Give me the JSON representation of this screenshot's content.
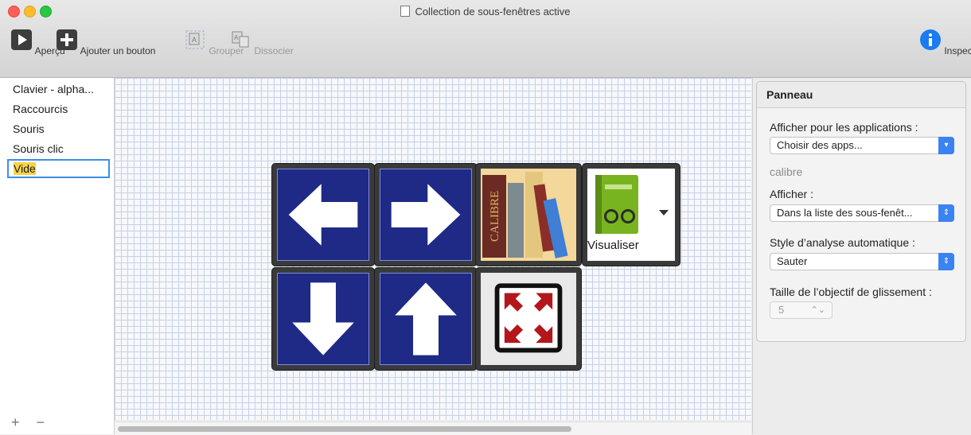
{
  "window": {
    "title": "Collection de sous-fenêtres active"
  },
  "toolbar": {
    "preview_label": "Aperçu",
    "add_button_label": "Ajouter un bouton",
    "group_label": "Grouper",
    "ungroup_label": "Dissocier",
    "inspector_label": "Inspecteur"
  },
  "sidebar": {
    "items": [
      {
        "label": "Clavier - alpha..."
      },
      {
        "label": "Raccourcis"
      },
      {
        "label": "Souris"
      },
      {
        "label": "Souris clic"
      },
      {
        "label": "Vide"
      }
    ],
    "bottom": "+ −"
  },
  "canvas": {
    "buttons": [
      {
        "name": "left-arrow",
        "icon": "arrow-left-icon"
      },
      {
        "name": "right-arrow",
        "icon": "arrow-right-icon"
      },
      {
        "name": "calibre",
        "icon": "calibre-books-icon",
        "text": "CALIBRE"
      },
      {
        "name": "visualiser",
        "icon": "green-book-glasses-icon",
        "label": "Visualiser"
      },
      {
        "name": "down-arrow",
        "icon": "arrow-down-icon"
      },
      {
        "name": "up-arrow",
        "icon": "arrow-up-icon"
      },
      {
        "name": "fullscreen",
        "icon": "expand-icon"
      }
    ]
  },
  "inspector": {
    "panel_title": "Panneau",
    "show_for_apps_label": "Afficher pour les applications :",
    "show_for_apps_value": "Choisir des apps...",
    "app_name": "calibre",
    "display_label": "Afficher :",
    "display_value": "Dans la liste des sous-fenêt...",
    "scan_style_label": "Style d’analyse automatique :",
    "scan_style_value": "Sauter",
    "swipe_target_label": "Taille de l’objectif de glissement :",
    "swipe_target_value": "5"
  },
  "colors": {
    "accent": "#3b82f2",
    "key_blue": "#1e2a86",
    "key_frame": "#3a3a3a"
  }
}
